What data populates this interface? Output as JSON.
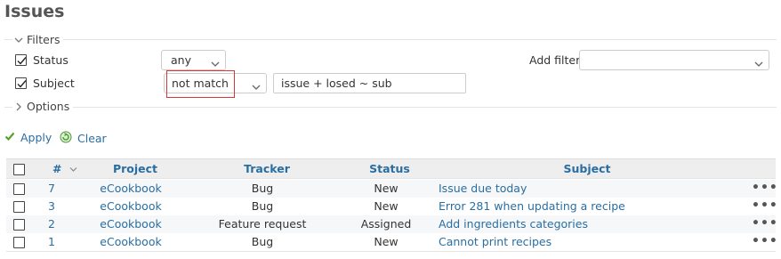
{
  "page": {
    "title": "Issues"
  },
  "filters": {
    "legend": "Filters",
    "rows": [
      {
        "label": "Status",
        "checked": true,
        "operator": "any"
      },
      {
        "label": "Subject",
        "checked": true,
        "operator": "not match",
        "value": "issue + losed ~ sub"
      }
    ],
    "add_filter_label": "Add filter",
    "add_filter_value": ""
  },
  "options": {
    "legend": "Options"
  },
  "actions": {
    "apply": "Apply",
    "clear": "Clear"
  },
  "table": {
    "columns": [
      "#",
      "Project",
      "Tracker",
      "Status",
      "Subject"
    ],
    "rows": [
      {
        "id": "7",
        "project": "eCookbook",
        "tracker": "Bug",
        "status": "New",
        "subject": "Issue due today"
      },
      {
        "id": "3",
        "project": "eCookbook",
        "tracker": "Bug",
        "status": "New",
        "subject": "Error 281 when updating a recipe"
      },
      {
        "id": "2",
        "project": "eCookbook",
        "tracker": "Feature request",
        "status": "Assigned",
        "subject": "Add ingredients categories"
      },
      {
        "id": "1",
        "project": "eCookbook",
        "tracker": "Bug",
        "status": "New",
        "subject": "Cannot print recipes"
      }
    ],
    "row_menu": "•••"
  },
  "colors": {
    "link": "#2a6ea1",
    "highlight": "#d43838",
    "apply_icon": "#5aa02c",
    "clear_icon": "#4a9a3a"
  }
}
